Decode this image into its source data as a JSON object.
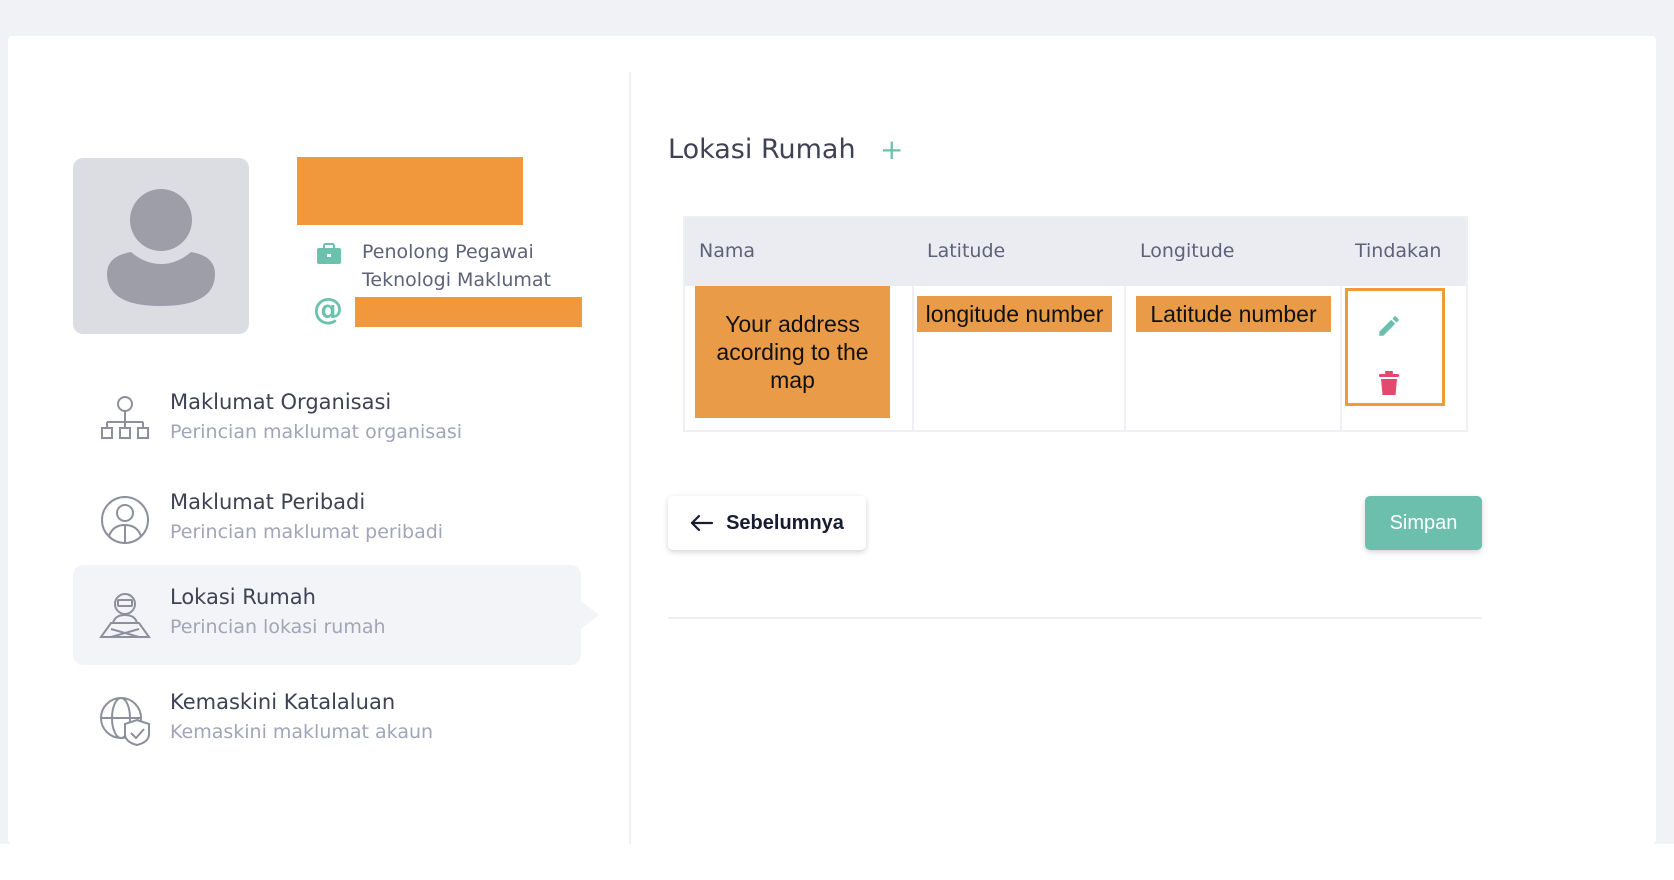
{
  "profile": {
    "role_line1": "Penolong Pegawai",
    "role_line2": "Teknologi Maklumat",
    "at_symbol": "@",
    "role_icon": "briefcase-icon",
    "avatar_icon": "user-avatar-icon"
  },
  "nav": {
    "items": [
      {
        "title": "Maklumat Organisasi",
        "subtitle": "Perincian maklumat organisasi",
        "icon": "org-chart-icon"
      },
      {
        "title": "Maklumat Peribadi",
        "subtitle": "Perincian maklumat peribadi",
        "icon": "person-icon"
      },
      {
        "title": "Lokasi Rumah",
        "subtitle": "Perincian lokasi rumah",
        "icon": "location-person-icon"
      },
      {
        "title": "Kemaskini Katalaluan",
        "subtitle": "Kemaskini maklumat akaun",
        "icon": "globe-shield-icon"
      }
    ],
    "active_index": 2
  },
  "main": {
    "title": "Lokasi Rumah",
    "add_symbol": "+",
    "table": {
      "headers": [
        "Nama",
        "Latitude",
        "Longitude",
        "Tindakan"
      ],
      "rows": [
        {
          "nama": "Your address acording to the map",
          "latitude": "longitude number",
          "longitude": "Latitude number"
        }
      ]
    },
    "prev_label": "Sebelumnya",
    "save_label": "Simpan"
  },
  "colors": {
    "accent": "#6cbfad",
    "delete": "#e5486e",
    "redaction": "#f0983b",
    "highlight_border": "#ef9b3c"
  }
}
